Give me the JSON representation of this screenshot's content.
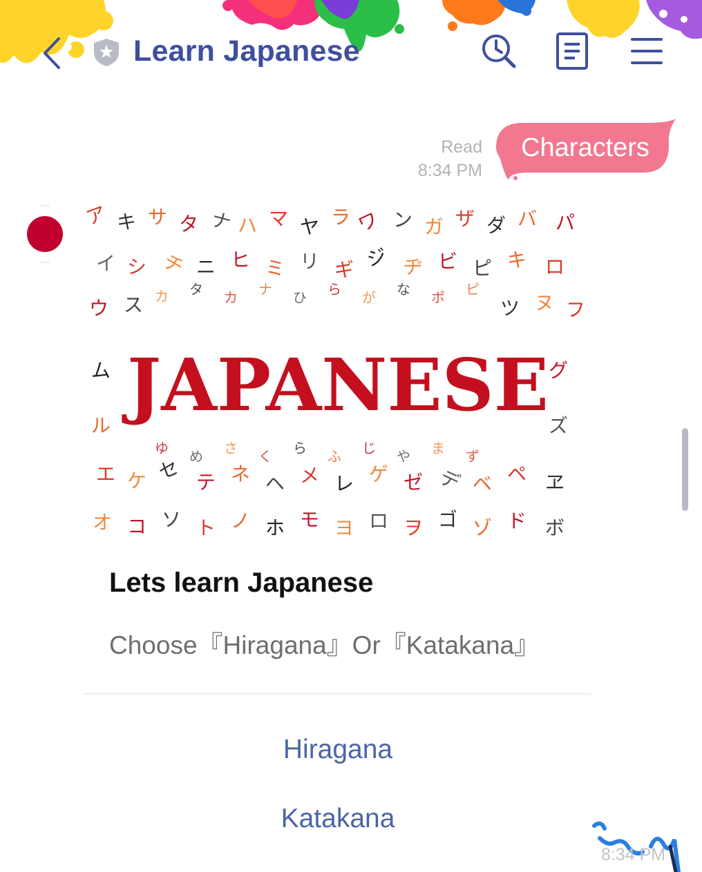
{
  "header": {
    "title": "Learn Japanese",
    "colors": {
      "title": "#3f4fa0",
      "icons": "#3f4fa0",
      "shield": "#b9bcc4"
    },
    "icons": [
      "back-arrow-icon",
      "shield-star-icon",
      "clock-search-icon",
      "notes-icon",
      "menu-icon"
    ]
  },
  "messages": {
    "sent": {
      "text": "Characters",
      "status": "Read",
      "time": "8:34 PM",
      "bubble_color": "#f1788f"
    },
    "card": {
      "image_text": "JAPANESE",
      "title": "Lets learn Japanese",
      "description": "Choose『Hiragana』Or『Katakana』",
      "actions": [
        "Hiragana",
        "Katakana"
      ],
      "action_color": "#4b65a6"
    },
    "bottom_time": "8:34 PM"
  }
}
